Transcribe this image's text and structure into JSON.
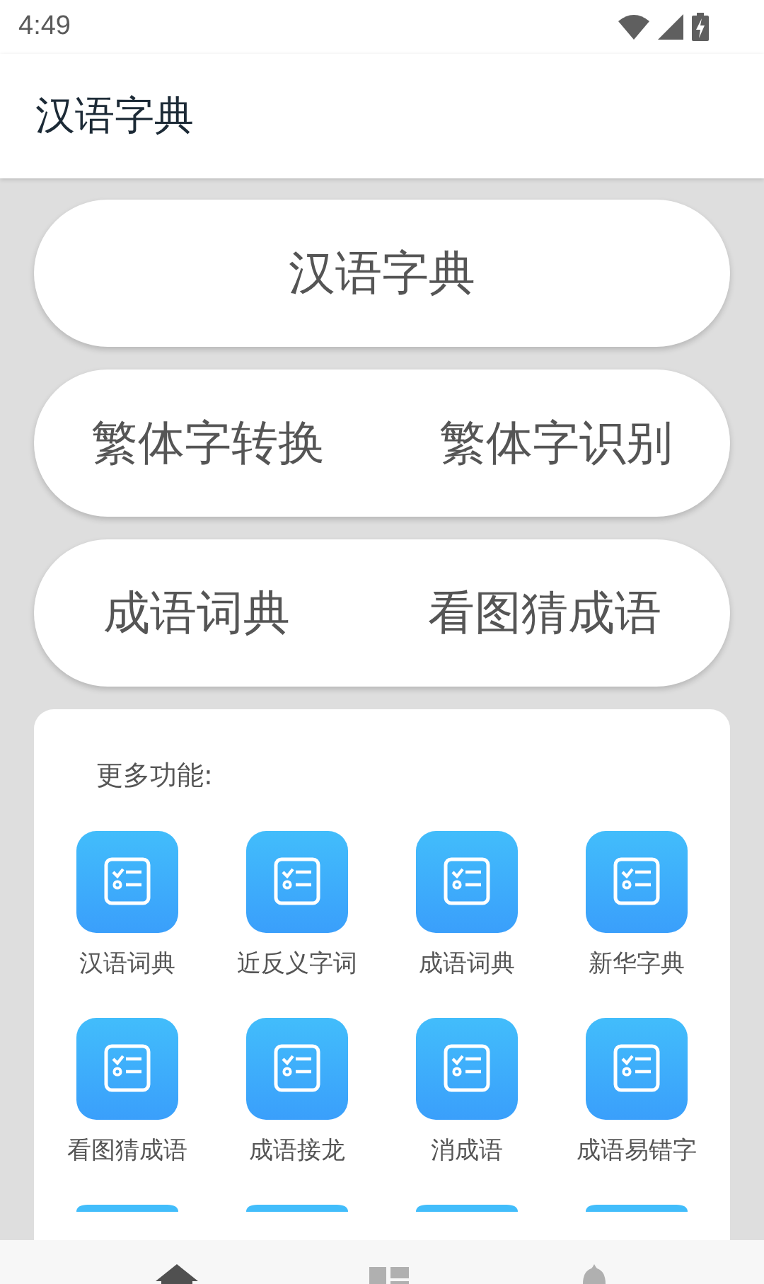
{
  "status_bar": {
    "time": "4:49"
  },
  "app_bar": {
    "title": "汉语字典"
  },
  "button_rows": [
    [
      "汉语字典"
    ],
    [
      "繁体字转换",
      "繁体字识别"
    ],
    [
      "成语词典",
      "看图猜成语"
    ]
  ],
  "more": {
    "title": "更多功能:",
    "items": [
      {
        "kind": "tile",
        "label": "汉语词典"
      },
      {
        "kind": "tile",
        "label": "近反义字词"
      },
      {
        "kind": "tile",
        "label": "成语词典"
      },
      {
        "kind": "tile",
        "label": "新华字典"
      },
      {
        "kind": "tile",
        "label": "看图猜成语"
      },
      {
        "kind": "tile",
        "label": "成语接龙"
      },
      {
        "kind": "tile",
        "label": "消成语"
      },
      {
        "kind": "tile",
        "label": "成语易错字"
      },
      {
        "kind": "cut"
      },
      {
        "kind": "cut"
      },
      {
        "kind": "cut"
      },
      {
        "kind": "cut"
      }
    ]
  },
  "bottom_nav": [
    {
      "kind": "home",
      "selected": true
    },
    {
      "kind": "dashboard",
      "selected": false
    },
    {
      "kind": "bell",
      "selected": false
    }
  ]
}
